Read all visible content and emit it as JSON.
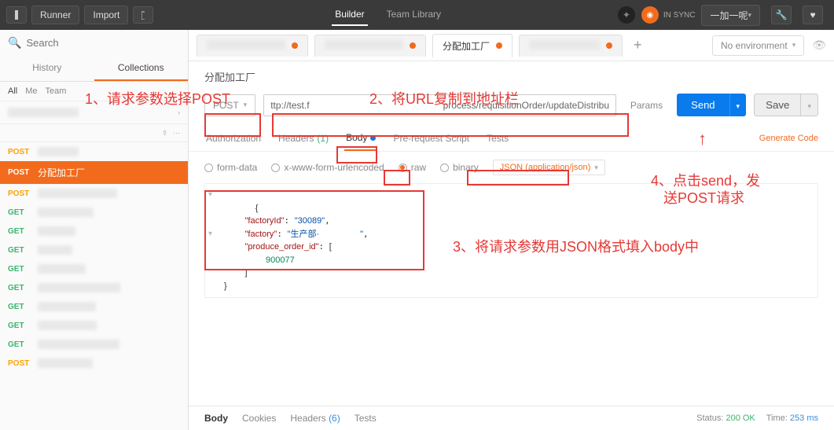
{
  "topbar": {
    "runner": "Runner",
    "import": "Import",
    "builder": "Builder",
    "team_library": "Team Library",
    "sync_label": "IN SYNC",
    "acct_label": "一加一呢"
  },
  "sidebar": {
    "search_placeholder": "Search",
    "history_tab": "History",
    "collections_tab": "Collections",
    "filter_all": "All",
    "filter_me": "Me",
    "filter_team": "Team",
    "active_request": "分配加工厂",
    "items": [
      {
        "method": "POST",
        "klass": "m-post"
      },
      {
        "method": "POST",
        "klass": "m-post",
        "label": "分配加工厂",
        "active": true
      },
      {
        "method": "POST",
        "klass": "m-post"
      },
      {
        "method": "GET",
        "klass": "m-get"
      },
      {
        "method": "GET",
        "klass": "m-get"
      },
      {
        "method": "GET",
        "klass": "m-get"
      },
      {
        "method": "GET",
        "klass": "m-get"
      },
      {
        "method": "GET",
        "klass": "m-get"
      },
      {
        "method": "GET",
        "klass": "m-get"
      },
      {
        "method": "GET",
        "klass": "m-get"
      },
      {
        "method": "GET",
        "klass": "m-get"
      },
      {
        "method": "POST",
        "klass": "m-post"
      }
    ]
  },
  "tabs": {
    "active_title": "分配加工厂",
    "env_label": "No environment"
  },
  "request": {
    "title": "分配加工厂",
    "method": "POST",
    "url": "ttp://test.f                                                   process/requisitionOrder/updateDistributeStatus",
    "params_btn": "Params",
    "send_btn": "Send",
    "save_btn": "Save"
  },
  "subtabs": {
    "auth": "Authorization",
    "headers": "Headers",
    "headers_count": "(1)",
    "body": "Body",
    "prerequest": "Pre-request Script",
    "tests": "Tests",
    "gen_code": "Generate Code"
  },
  "body_type": {
    "form": "form-data",
    "urlenc": "x-www-form-urlencoded",
    "raw": "raw",
    "binary": "binary",
    "json_select": "JSON (application/json)"
  },
  "editor_json": {
    "line1_open": "{",
    "line2_key": "\"factoryId\"",
    "line2_val": "\"30089\"",
    "line3_key": "\"factory\"",
    "line3_val": "\"生产部·                 \"",
    "line4_key": "\"produce_order_id\"",
    "line4_open": "[",
    "line5_val": "900077",
    "line6_close": "]",
    "line7_close": "}"
  },
  "response": {
    "body": "Body",
    "cookies": "Cookies",
    "headers": "Headers",
    "headers_count": "(6)",
    "tests": "Tests",
    "status_label": "Status:",
    "status_value": "200 OK",
    "time_label": "Time:",
    "time_value": "253 ms"
  },
  "annotations": {
    "a1": "1、请求参数选择POST",
    "a2": "2、将URL复制到地址栏",
    "a3": "3、将请求参数用JSON格式填入body中",
    "a4a": "4、点击send，发",
    "a4b": "送POST请求"
  }
}
